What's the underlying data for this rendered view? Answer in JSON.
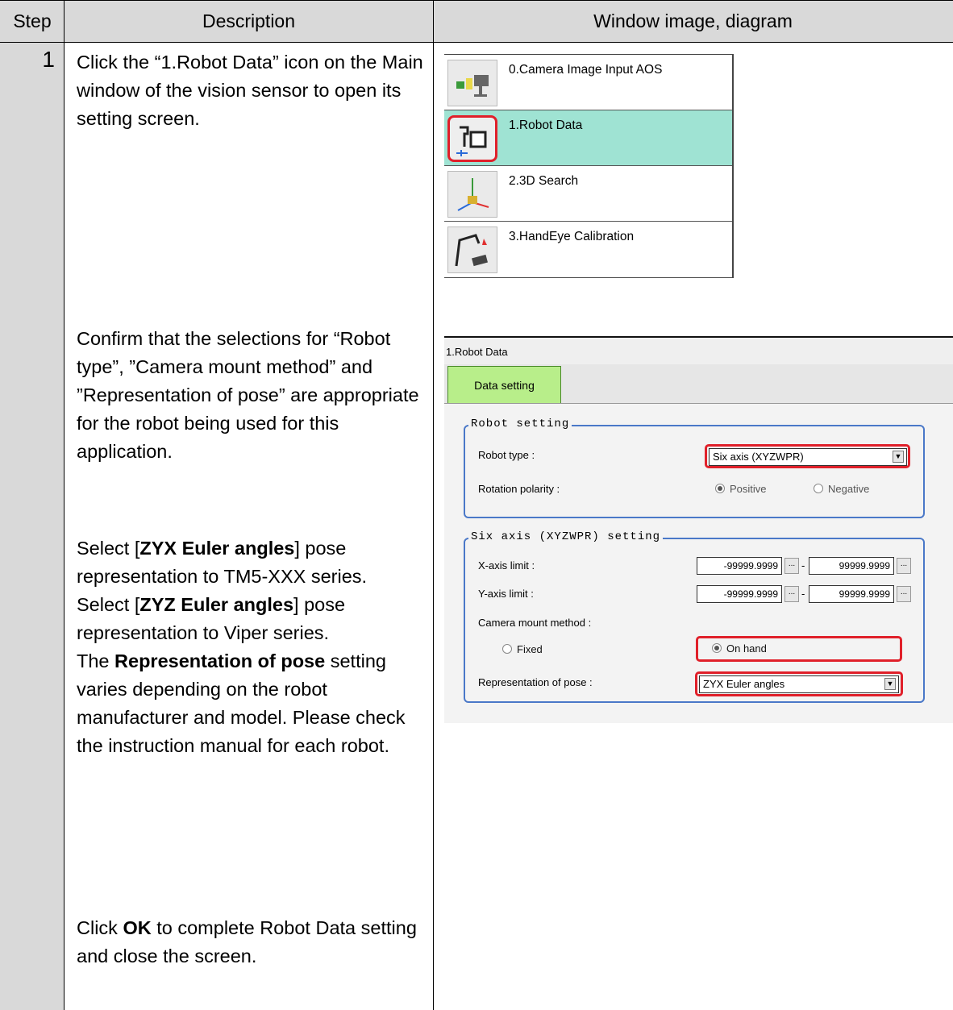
{
  "table": {
    "headers": {
      "step": "Step",
      "description": "Description",
      "window": "Window image, diagram"
    },
    "step_number": "1",
    "paragraphs": [
      {
        "parts": [
          {
            "text": "Click the “1.Robot Data” icon on the Main window of the vision sensor to open its setting screen."
          }
        ]
      },
      {
        "parts": [
          {
            "text": "Confirm that the selections for “Robot type”, ”Camera mount method” and ”Representation of pose” are appropriate for the robot being used for this application."
          }
        ]
      },
      {
        "parts": [
          {
            "text": "Select ["
          },
          {
            "text": "ZYX Euler angles",
            "bold": true
          },
          {
            "text": "] pose representation to TM5-XXX series."
          }
        ]
      },
      {
        "parts": [
          {
            "text": "Select ["
          },
          {
            "text": "ZYZ Euler angles",
            "bold": true
          },
          {
            "text": "] pose representation to Viper series."
          }
        ]
      },
      {
        "parts": [
          {
            "text": "The "
          },
          {
            "text": "Representation of pose",
            "bold": true
          },
          {
            "text": " setting varies depending on the robot manufacturer and model. Please check the instruction manual for each robot."
          }
        ]
      },
      {
        "parts": [
          {
            "text": "Click "
          },
          {
            "text": "OK",
            "bold": true
          },
          {
            "text": " to complete Robot Data setting and close the screen."
          }
        ]
      }
    ]
  },
  "icon_list": {
    "items": [
      {
        "label": "0.Camera Image Input AOS",
        "icon": "camera-input-icon"
      },
      {
        "label": "1.Robot Data",
        "icon": "robot-data-icon",
        "selected": true
      },
      {
        "label": "2.3D Search",
        "icon": "3d-search-icon"
      },
      {
        "label": "3.HandEye Calibration",
        "icon": "handeye-calibration-icon"
      }
    ]
  },
  "dialog": {
    "title": "1.Robot Data",
    "tab": "Data setting",
    "robot_setting": {
      "legend": "Robot setting",
      "robot_type_label": "Robot type :",
      "robot_type_value": "Six axis (XYZWPR)",
      "rotation_polarity_label": "Rotation polarity :",
      "positive": "Positive",
      "negative": "Negative"
    },
    "six_axis_setting": {
      "legend": "Six axis (XYZWPR) setting",
      "x_axis_label": "X-axis limit :",
      "x_min": "-99999.9999",
      "x_max": "99999.9999",
      "y_axis_label": "Y-axis limit :",
      "y_min": "-99999.9999",
      "y_max": "99999.9999",
      "range_dash": "-",
      "ellipsis": "...",
      "camera_mount_label": "Camera mount method :",
      "fixed": "Fixed",
      "on_hand": "On hand",
      "pose_label": "Representation of pose :",
      "pose_value": "ZYX Euler angles"
    }
  },
  "colors": {
    "highlight": "#e0202a",
    "selected_row": "#9fe3d3",
    "tab": "#b8ee8a",
    "group_border": "#4a78c8"
  }
}
